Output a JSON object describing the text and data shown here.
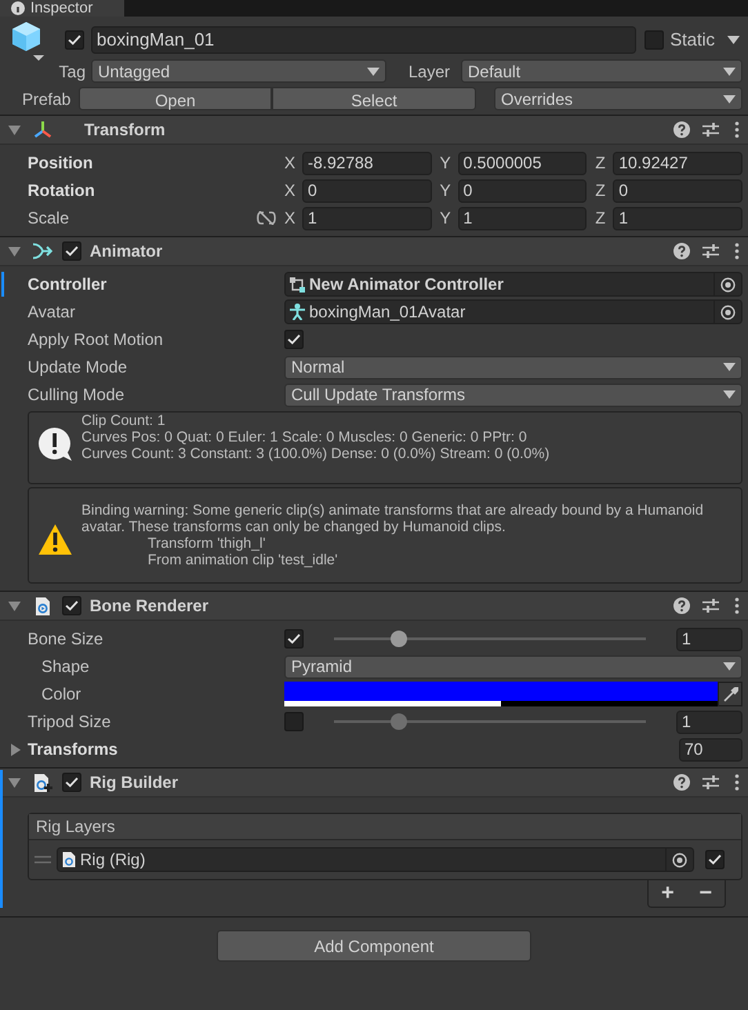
{
  "tab": {
    "label": "Inspector"
  },
  "object": {
    "active": true,
    "name": "boxingMan_01",
    "static": false,
    "static_label": "Static",
    "tag_label": "Tag",
    "tag": "Untagged",
    "layer_label": "Layer",
    "layer": "Default",
    "prefab_label": "Prefab",
    "prefab_buttons": [
      "Open",
      "Select"
    ],
    "overrides": "Overrides"
  },
  "components": [
    {
      "kind": "transform",
      "title": "Transform",
      "expanded": true,
      "added": false,
      "rows": [
        {
          "kind": "vector3",
          "label": "Position",
          "overridden": true,
          "axes": [
            {
              "axis": "X",
              "value": "-8.92788"
            },
            {
              "axis": "Y",
              "value": "0.5000005"
            },
            {
              "axis": "Z",
              "value": "10.92427"
            }
          ]
        },
        {
          "kind": "vector3",
          "label": "Rotation",
          "overridden": true,
          "axes": [
            {
              "axis": "X",
              "value": "0"
            },
            {
              "axis": "Y",
              "value": "0"
            },
            {
              "axis": "Z",
              "value": "0"
            }
          ]
        },
        {
          "kind": "vector3",
          "label": "Scale",
          "overridden": false,
          "linked": false,
          "axes": [
            {
              "axis": "X",
              "value": "1"
            },
            {
              "axis": "Y",
              "value": "1"
            },
            {
              "axis": "Z",
              "value": "1"
            }
          ]
        }
      ]
    },
    {
      "kind": "animator",
      "title": "Animator",
      "expanded": true,
      "enabled": true,
      "added": false,
      "rows": [
        {
          "kind": "controller",
          "label": "Controller",
          "overridden": true,
          "value": "New Animator Controller"
        },
        {
          "kind": "avatar",
          "label": "Avatar",
          "overridden": false,
          "value": "boxingMan_01Avatar"
        },
        {
          "kind": "toggle",
          "label": "Apply Root Motion",
          "overridden": false,
          "checked": true
        },
        {
          "kind": "dropdown",
          "label": "Update Mode",
          "overridden": false,
          "value": "Normal"
        },
        {
          "kind": "dropdown",
          "label": "Culling Mode",
          "overridden": false,
          "value": "Cull Update Transforms"
        },
        {
          "kind": "info",
          "lines": [
            "Clip Count: 1",
            "Curves Pos: 0 Quat: 0 Euler: 1 Scale: 0 Muscles: 0 Generic: 0 PPtr: 0",
            "Curves Count: 3 Constant: 3 (100.0%) Dense: 0 (0.0%) Stream: 0 (0.0%)"
          ]
        },
        {
          "kind": "warning",
          "lines": [
            "Binding warning: Some generic clip(s) animate transforms that are already bound by a Humanoid avatar. These transforms can only be changed by Humanoid clips.",
            "Transform 'thigh_l'",
            "From animation clip 'test_idle'"
          ]
        }
      ]
    },
    {
      "kind": "script",
      "title": "Bone Renderer",
      "expanded": true,
      "enabled": true,
      "added": false,
      "rows": [
        {
          "kind": "slider",
          "label": "Bone Size",
          "overridden": false,
          "checked": true,
          "level": 0.21,
          "value": "1"
        },
        {
          "kind": "dropdown",
          "label": "Shape",
          "overridden": false,
          "indented": true,
          "value": "Pyramid"
        },
        {
          "kind": "color",
          "label": "Color",
          "overridden": false,
          "indented": true,
          "color": "#0000ff",
          "level": 0.5
        },
        {
          "kind": "slider",
          "label": "Tripod Size",
          "overridden": false,
          "checked": false,
          "level": 0.21,
          "value": "1"
        },
        {
          "kind": "foldout",
          "label": "Transforms",
          "overridden": true,
          "expanded": false,
          "value": "70"
        }
      ]
    },
    {
      "kind": "rig",
      "title": "Rig Builder",
      "expanded": true,
      "enabled": true,
      "added": true,
      "rows": [
        {
          "kind": "list",
          "label": "Rig Layers",
          "items": [
            {
              "value": "Rig (Rig)",
              "checked": true
            }
          ],
          "buttons": [
            "+",
            "−"
          ]
        }
      ]
    }
  ],
  "add_component": "Add Component"
}
